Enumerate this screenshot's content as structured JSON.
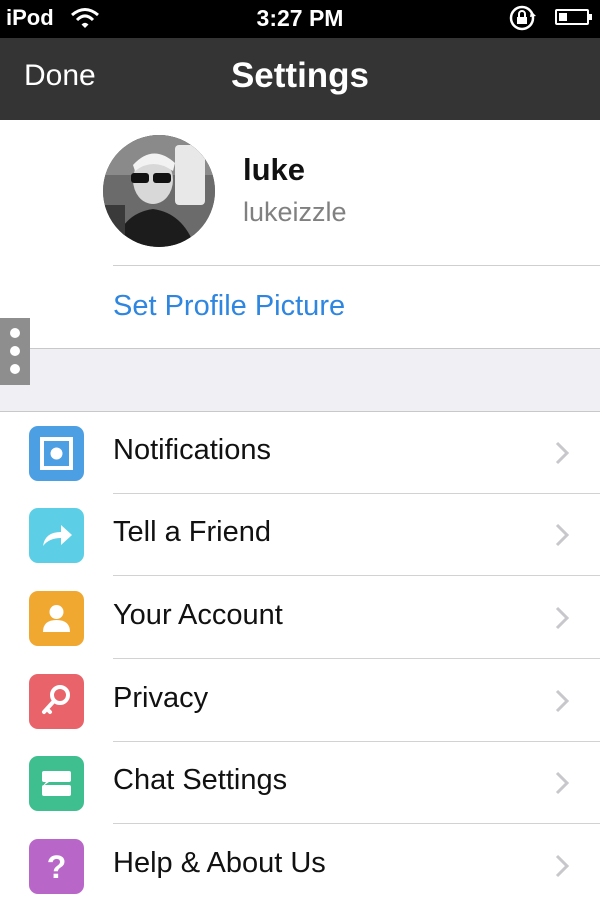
{
  "status_bar": {
    "carrier": "iPod",
    "time": "3:27 PM"
  },
  "nav": {
    "back_label": "Done",
    "title": "Settings"
  },
  "profile": {
    "name": "luke",
    "username": "lukeizzle",
    "set_picture_label": "Set Profile Picture"
  },
  "menu": [
    {
      "label": "Notifications",
      "icon": "notifications-icon",
      "color": "#4d9fe3"
    },
    {
      "label": "Tell a Friend",
      "icon": "share-arrow-icon",
      "color": "#5ccfe6"
    },
    {
      "label": "Your Account",
      "icon": "person-icon",
      "color": "#f0a830"
    },
    {
      "label": "Privacy",
      "icon": "key-icon",
      "color": "#e9646a"
    },
    {
      "label": "Chat Settings",
      "icon": "chat-icon",
      "color": "#3fbf8f"
    },
    {
      "label": "Help & About Us",
      "icon": "question-icon",
      "color": "#b867c9"
    }
  ],
  "colors": {
    "link": "#2f86e0",
    "nav_background": "#343434"
  }
}
